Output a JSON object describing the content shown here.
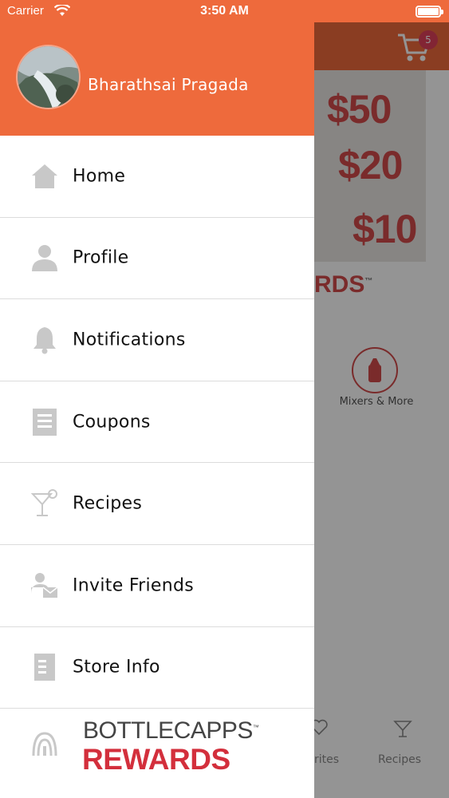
{
  "status_bar": {
    "carrier": "Carrier",
    "time": "3:50 AM"
  },
  "drawer": {
    "user_name": "Bharathsai Pragada",
    "menu": [
      {
        "label": "Home",
        "icon": "home-icon"
      },
      {
        "label": "Profile",
        "icon": "person-icon"
      },
      {
        "label": "Notifications",
        "icon": "bell-icon"
      },
      {
        "label": "Coupons",
        "icon": "coupon-icon"
      },
      {
        "label": "Recipes",
        "icon": "cocktail-icon"
      },
      {
        "label": "Invite Friends",
        "icon": "invite-icon"
      },
      {
        "label": "Store Info",
        "icon": "document-icon"
      }
    ],
    "footer": {
      "brand_top": "BOTTLECAPPS",
      "brand_tm": "™",
      "brand_bottom": "REWARDS"
    }
  },
  "background": {
    "cart_count": "5",
    "banner_values": [
      "$50",
      "$20",
      "$10"
    ],
    "rewards_fragment": "RDS",
    "category_label": "Mixers & More",
    "tabs": [
      {
        "label": "rites"
      },
      {
        "label": "Recipes"
      }
    ]
  },
  "colors": {
    "accent": "#ee6a3c",
    "brand_red": "#d32f3c",
    "icon_gray": "#c8c8c8"
  }
}
